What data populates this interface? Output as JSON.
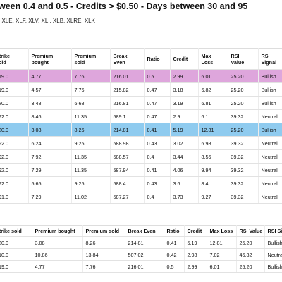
{
  "header": {
    "title": "ween 0.4 and 0.5 - Credits > $0.50 - Days between 30 and 95",
    "tickers": ", XLE, XLF, XLV, XLI, XLB, XLRE, XLK"
  },
  "colors": {
    "pink_highlight": "#dea6dc",
    "blue_highlight": "#8fcbef"
  },
  "table1": {
    "columns": [
      "Strike\nsold",
      "Premium\nbought",
      "Premium\nsold",
      "Break\nEven",
      "Ratio",
      "Credit",
      "Max\nLoss",
      "RSI\nValue",
      "RSI\nSignal"
    ],
    "rows": [
      [
        "219.0",
        "4.77",
        "7.76",
        "216.01",
        "0.5",
        "2.99",
        "6.01",
        "25.20",
        "Bullish"
      ],
      [
        "219.0",
        "4.57",
        "7.76",
        "215.82",
        "0.47",
        "3.18",
        "6.82",
        "25.20",
        "Bullish"
      ],
      [
        "220.0",
        "3.48",
        "6.68",
        "216.81",
        "0.47",
        "3.19",
        "6.81",
        "25.20",
        "Bullish"
      ],
      [
        "592.0",
        "8.46",
        "11.35",
        "589.1",
        "0.47",
        "2.9",
        "6.1",
        "39.32",
        "Neutral"
      ],
      [
        "220.0",
        "3.08",
        "8.26",
        "214.81",
        "0.41",
        "5.19",
        "12.81",
        "25.20",
        "Bullish"
      ],
      [
        "592.0",
        "6.24",
        "9.25",
        "588.98",
        "0.43",
        "3.02",
        "6.98",
        "39.32",
        "Neutral"
      ],
      [
        "592.0",
        "7.92",
        "11.35",
        "588.57",
        "0.4",
        "3.44",
        "8.56",
        "39.32",
        "Neutral"
      ],
      [
        "592.0",
        "7.29",
        "11.35",
        "587.94",
        "0.41",
        "4.06",
        "9.94",
        "39.32",
        "Neutral"
      ],
      [
        "592.0",
        "5.65",
        "9.25",
        "588.4",
        "0.43",
        "3.6",
        "8.4",
        "39.32",
        "Neutral"
      ],
      [
        "591.0",
        "7.29",
        "11.02",
        "587.27",
        "0.4",
        "3.73",
        "9.27",
        "39.32",
        "Neutral"
      ]
    ],
    "highlight": {
      "0": "hl-pink",
      "4": "hl-blue"
    }
  },
  "table2": {
    "columns": [
      "Strike sold",
      "Premium bought",
      "Premium sold",
      "Break Even",
      "Ratio",
      "Credit",
      "Max Loss",
      "RSI Value",
      "RSI Sig"
    ],
    "rows": [
      [
        "220.0",
        "3.08",
        "8.26",
        "214.81",
        "0.41",
        "5.19",
        "12.81",
        "25.20",
        "Bullish"
      ],
      [
        "510.0",
        "10.86",
        "13.84",
        "507.02",
        "0.42",
        "2.98",
        "7.02",
        "46.32",
        "Neutral"
      ],
      [
        "219.0",
        "4.77",
        "7.76",
        "216.01",
        "0.5",
        "2.99",
        "6.01",
        "25.20",
        "Bullish"
      ]
    ]
  }
}
